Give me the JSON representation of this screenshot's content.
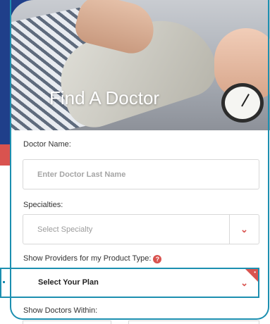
{
  "hero": {
    "title": "Find A Doctor"
  },
  "form": {
    "doctor_name_label": "Doctor Name:",
    "doctor_name_placeholder": "Enter Doctor Last Name",
    "specialties_label": "Specialties:",
    "specialty_select_value": "Select Specialty",
    "product_type_label": "Show Providers for my Product Type:",
    "help_icon": "?",
    "plan_select_value": "Select Your Plan",
    "distance_label": "Show Doctors Within:"
  },
  "icons": {
    "select_arrow": "⌄",
    "help": "question-circle-icon"
  },
  "colors": {
    "navy": "#1f3f8a",
    "accent_red": "#d9534f",
    "frame_teal": "#1c8fb0"
  }
}
